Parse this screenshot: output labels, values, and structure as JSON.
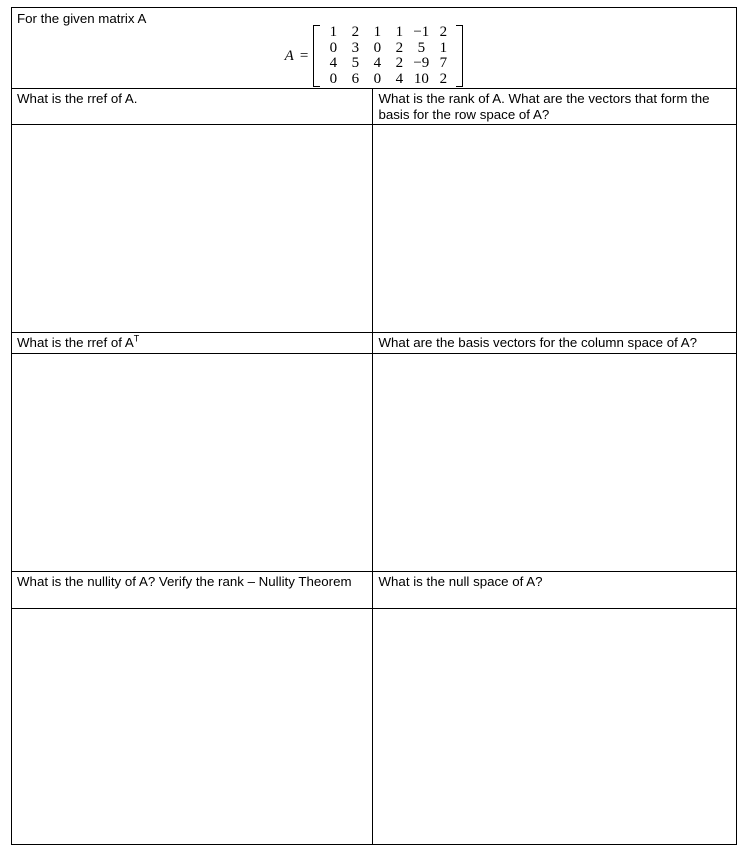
{
  "document": {
    "prompt": "For the given matrix A",
    "matrix": {
      "name": "A",
      "equals": "=",
      "rows": [
        [
          "1",
          "2",
          "1",
          "1",
          "−1",
          "2"
        ],
        [
          "0",
          "3",
          "0",
          "2",
          "5",
          "1"
        ],
        [
          "4",
          "5",
          "4",
          "2",
          "−9",
          "7"
        ],
        [
          "0",
          "6",
          "0",
          "4",
          "10",
          "2"
        ]
      ]
    },
    "questions": [
      {
        "left": "What is the rref of A.",
        "right": "What is the rank of A.  What are the vectors that form the basis for the row space of A?"
      },
      {
        "left_prefix": "What is the rref of A",
        "left_sup": "T",
        "right": "What are the basis vectors for the column space of A?"
      },
      {
        "left": "What is the nullity of A?   Verify the rank – Nullity Theorem",
        "right": "What is the null space of A?"
      }
    ],
    "answers": {
      "rref_a": "",
      "rank_row_space": "",
      "rref_a_transpose": "",
      "column_space": "",
      "nullity": "",
      "null_space": ""
    }
  },
  "colors": {
    "border": "#000000",
    "text": "#000000",
    "background": "#ffffff"
  }
}
